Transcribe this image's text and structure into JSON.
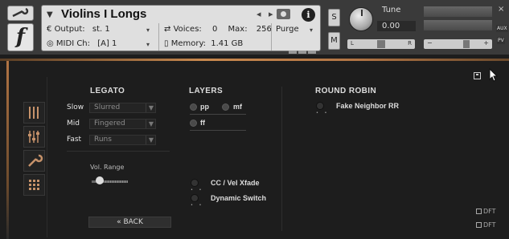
{
  "header": {
    "instrument_title": "Violins I Longs",
    "output_label": "Output:",
    "output_value": "st. 1",
    "midi_label": "MIDI Ch:",
    "midi_value": "[A]  1",
    "voices_label": "Voices:",
    "voices_value": "0",
    "max_label": "Max:",
    "max_value": "256",
    "memory_label": "Memory:",
    "memory_value": "1.41 GB",
    "purge_label": "Purge",
    "info_icon_text": "i",
    "logo_text": "f",
    "solo_label": "S",
    "mute_label": "M",
    "tune_label": "Tune",
    "tune_value": "0.00",
    "pan_left": "L",
    "pan_right": "R",
    "vol_minus": "−",
    "vol_plus": "+",
    "aux_label": "AUX",
    "pv_label": "PV",
    "close_label": "×",
    "nav_prev": "◂",
    "nav_next": "▸"
  },
  "legato": {
    "heading": "LEGATO",
    "rows": [
      {
        "label": "Slow",
        "value": "Slurred"
      },
      {
        "label": "Mid",
        "value": "Fingered"
      },
      {
        "label": "Fast",
        "value": "Runs"
      }
    ],
    "vol_range_label": "Vol. Range"
  },
  "layers": {
    "heading": "LAYERS",
    "items": [
      "pp",
      "mf",
      "ff"
    ],
    "cc_xfade_label": "CC / Vel Xfade",
    "dynamic_switch_label": "Dynamic Switch"
  },
  "round_robin": {
    "heading": "ROUND ROBIN",
    "fake_neighbor_label": "Fake Neighbor RR"
  },
  "footer": {
    "back_label": "« BACK",
    "dft_save": "DFT",
    "dft_load": "DFT"
  },
  "colors": {
    "accent_copper": "#c9894f",
    "panel_bg": "#1d1d1d",
    "header_bg": "#3a3a3a"
  },
  "icons": {
    "tabs": [
      "faders-vertical-icon",
      "mixer-sliders-icon",
      "wrench-icon",
      "grid-icon"
    ]
  }
}
